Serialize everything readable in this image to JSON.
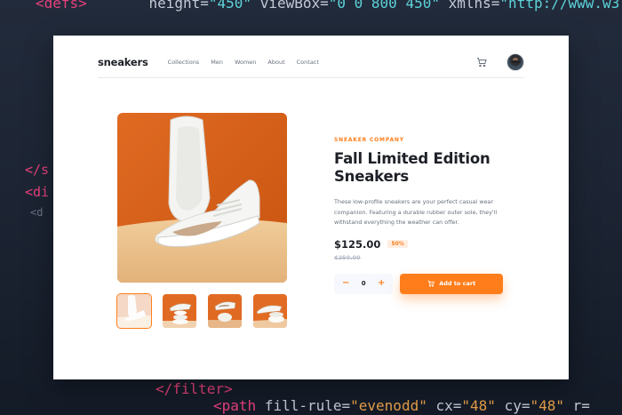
{
  "background_code": {
    "top": [
      "<defs>",
      "height=",
      "\"450\"",
      "viewBox=",
      "\"0 0 800 450\"",
      "xmlns=",
      "\"http://www.w3.org/2000/svg\""
    ],
    "side": [
      "</s",
      "<di",
      "<d"
    ],
    "bottom1": [
      "</filter>"
    ],
    "bottom2": [
      "<path",
      "fill-rule=",
      "\"evenodd\"",
      "cx=",
      "\"48\"",
      "cy=",
      "\"48\"",
      "r="
    ]
  },
  "nav": {
    "logo": "sneakers",
    "links": [
      "Collections",
      "Men",
      "Women",
      "About",
      "Contact"
    ],
    "cart_icon": "cart-icon",
    "avatar_icon": "avatar"
  },
  "product": {
    "company": "SNEAKER COMPANY",
    "title": "Fall Limited Edition Sneakers",
    "description": "These low-profile sneakers are your perfect casual wear companion. Featuring a durable rubber outer sole, they'll withstand everything the weather can offer.",
    "price": "$125.00",
    "discount": "50%",
    "old_price": "$250.00"
  },
  "cart": {
    "minus": "−",
    "quantity": "0",
    "plus": "+",
    "add_label": "Add to cart"
  },
  "colors": {
    "accent": "#ff7e1b",
    "accent_pale": "#ffede0",
    "text_dark": "#1d2026",
    "text_grey": "#69707d"
  }
}
